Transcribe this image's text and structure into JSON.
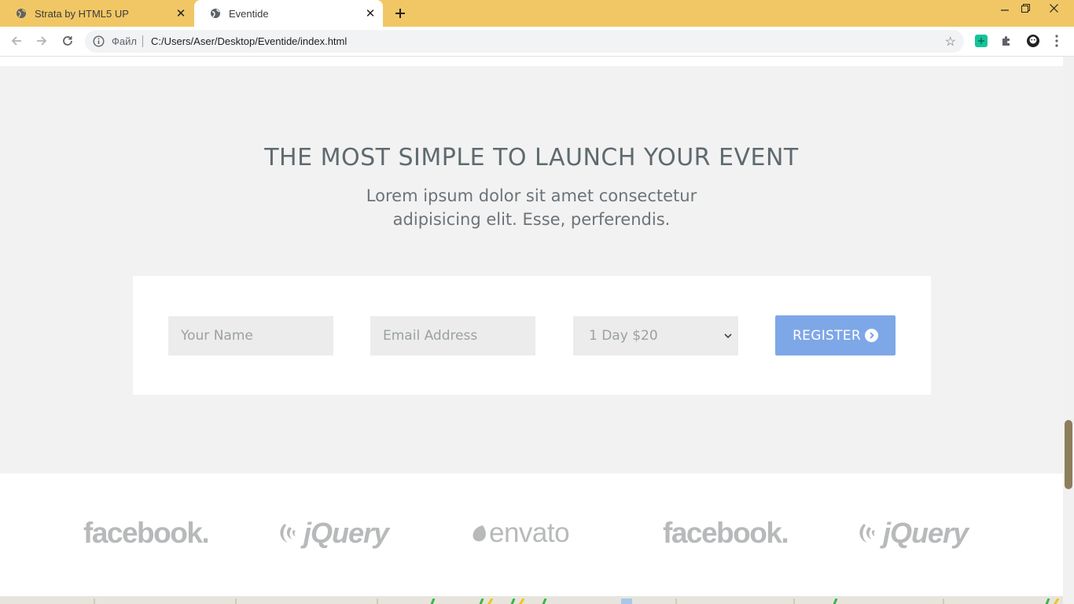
{
  "browser": {
    "tabs": [
      {
        "title": "Strata by HTML5 UP",
        "active": false
      },
      {
        "title": "Eventide",
        "active": true
      }
    ],
    "address": {
      "scheme_label": "Файл",
      "url": "C:/Users/Aser/Desktop/Eventide/index.html"
    },
    "accent_color": "#f1c765"
  },
  "hero": {
    "title": "THE MOST SIMPLE TO LAUNCH YOUR EVENT",
    "subtitle": "Lorem ipsum dolor sit amet consectetur adipisicing elit. Esse, perferendis."
  },
  "form": {
    "name_placeholder": "Your Name",
    "email_placeholder": "Email Address",
    "ticket_selected": "1 Day $20",
    "register_label": "REGISTER",
    "button_color": "#7ea7e7"
  },
  "logos": [
    "facebook.",
    "jQuery",
    "envato",
    "facebook.",
    "jQuery"
  ]
}
